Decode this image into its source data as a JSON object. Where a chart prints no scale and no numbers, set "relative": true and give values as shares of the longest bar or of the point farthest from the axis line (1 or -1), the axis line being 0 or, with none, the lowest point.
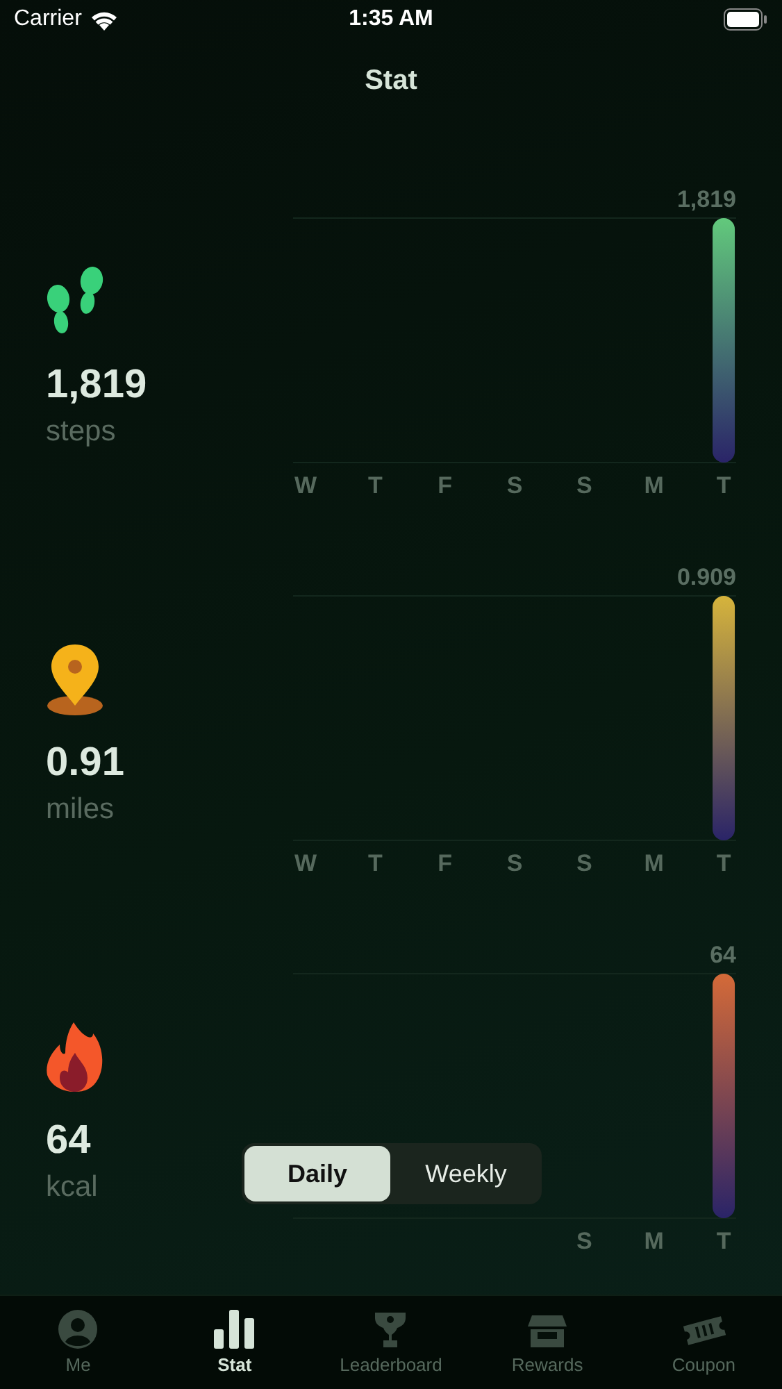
{
  "status_bar": {
    "carrier": "Carrier",
    "time": "1:35 AM"
  },
  "title": "Stat",
  "metrics": [
    {
      "kind": "steps",
      "value": "1,819",
      "unit": "steps",
      "chart_data": {
        "type": "bar",
        "relative": true,
        "categories": [
          "W",
          "T",
          "F",
          "S",
          "S",
          "M",
          "T"
        ],
        "series": [
          {
            "color": "#62c97c",
            "values": [
              0,
              0,
              0,
              0,
              0,
              0,
              1
            ]
          }
        ],
        "annotations": [
          {
            "text": "1,819"
          }
        ]
      }
    },
    {
      "kind": "distance",
      "value": "0.91",
      "unit": "miles",
      "chart_data": {
        "type": "bar",
        "relative": true,
        "categories": [
          "W",
          "T",
          "F",
          "S",
          "S",
          "M",
          "T"
        ],
        "series": [
          {
            "color": "#d6b43c",
            "values": [
              0,
              0,
              0,
              0,
              0,
              0,
              1
            ]
          }
        ],
        "annotations": [
          {
            "text": "0.909"
          }
        ]
      }
    },
    {
      "kind": "calories",
      "value": "64",
      "unit": "kcal",
      "chart_data": {
        "type": "bar",
        "relative": true,
        "categories": [
          null,
          null,
          null,
          null,
          "S",
          "M",
          "T"
        ],
        "series": [
          {
            "color": "#d46a38",
            "values": [
              0,
              0,
              0,
              0,
              0,
              0,
              1
            ]
          }
        ],
        "annotations": [
          {
            "text": "64"
          }
        ]
      }
    }
  ],
  "period_toggle": [
    {
      "label": "Daily",
      "selected": true
    },
    {
      "label": "Weekly",
      "selected": false
    }
  ],
  "tab_bar": [
    {
      "label": "Me",
      "kind": "person",
      "selected": false
    },
    {
      "label": "Stat",
      "kind": "chart",
      "selected": true
    },
    {
      "label": "Leaderboard",
      "kind": "trophy",
      "selected": false
    },
    {
      "label": "Rewards",
      "kind": "shop",
      "selected": false
    },
    {
      "label": "Coupon",
      "kind": "ticket",
      "selected": false
    }
  ]
}
